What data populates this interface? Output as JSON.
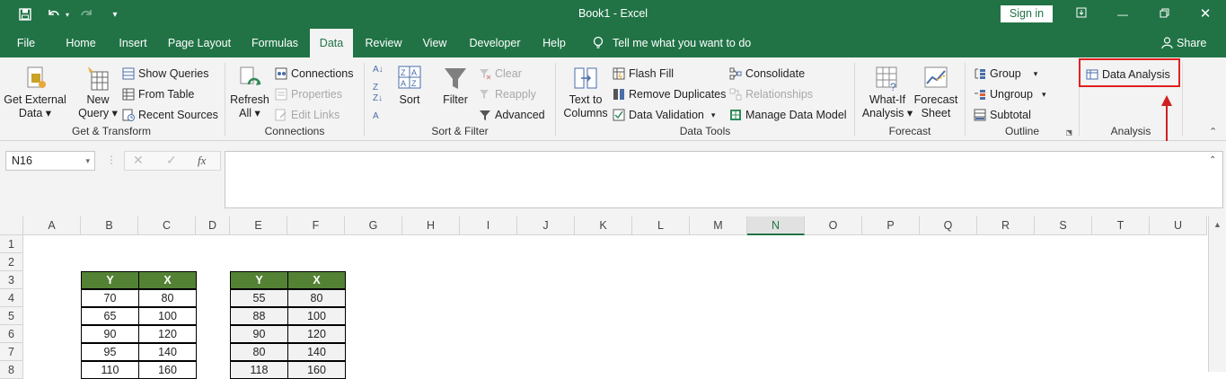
{
  "window": {
    "title": "Book1  -  Excel",
    "signin_label": "Sign in"
  },
  "qat": {
    "icons": [
      "save-icon",
      "undo-icon",
      "redo-icon",
      "customize-icon"
    ]
  },
  "tabs": [
    "File",
    "Home",
    "Insert",
    "Page Layout",
    "Formulas",
    "Data",
    "Review",
    "View",
    "Developer",
    "Help"
  ],
  "active_tab": "Data",
  "tellme": "Tell me what you want to do",
  "share": "Share",
  "ribbon": {
    "get_transform": {
      "get_external": "Get External",
      "get_external2": "Data",
      "new_query": "New",
      "new_query2": "Query",
      "show_queries": "Show Queries",
      "from_table": "From Table",
      "recent_sources": "Recent Sources",
      "label": "Get & Transform"
    },
    "connections": {
      "refresh": "Refresh",
      "refresh2": "All",
      "connections": "Connections",
      "properties": "Properties",
      "edit_links": "Edit Links",
      "label": "Connections"
    },
    "sort_filter": {
      "sort": "Sort",
      "filter": "Filter",
      "clear": "Clear",
      "reapply": "Reapply",
      "advanced": "Advanced",
      "label": "Sort & Filter"
    },
    "data_tools": {
      "text_to": "Text to",
      "columns": "Columns",
      "flash_fill": "Flash Fill",
      "remove_duplicates": "Remove Duplicates",
      "data_validation": "Data Validation",
      "consolidate": "Consolidate",
      "relationships": "Relationships",
      "manage_model": "Manage Data Model",
      "label": "Data Tools"
    },
    "forecast": {
      "whatif": "What-If",
      "whatif2": "Analysis",
      "forecast": "Forecast",
      "forecast2": "Sheet",
      "label": "Forecast"
    },
    "outline": {
      "group": "Group",
      "ungroup": "Ungroup",
      "subtotal": "Subtotal",
      "label": "Outline"
    },
    "analysis": {
      "data_analysis": "Data Analysis",
      "label": "Analysis"
    }
  },
  "formula_bar": {
    "name_box": "N16",
    "fx": "fx",
    "content": ""
  },
  "columns": [
    "A",
    "B",
    "C",
    "D",
    "E",
    "F",
    "G",
    "H",
    "I",
    "J",
    "K",
    "L",
    "M",
    "N",
    "O",
    "P",
    "Q",
    "R",
    "S",
    "T",
    "U"
  ],
  "selected_column": "N",
  "rows": [
    "1",
    "2",
    "3",
    "4",
    "5",
    "6",
    "7",
    "8"
  ],
  "table1": {
    "headers": [
      "Y",
      "X"
    ],
    "rows": [
      [
        "70",
        "80"
      ],
      [
        "65",
        "100"
      ],
      [
        "90",
        "120"
      ],
      [
        "95",
        "140"
      ],
      [
        "110",
        "160"
      ]
    ]
  },
  "table2": {
    "headers": [
      "Y",
      "X"
    ],
    "rows": [
      [
        "55",
        "80"
      ],
      [
        "88",
        "100"
      ],
      [
        "90",
        "120"
      ],
      [
        "80",
        "140"
      ],
      [
        "118",
        "160"
      ]
    ]
  },
  "colors": {
    "excel_green": "#217346",
    "header_green": "#548235",
    "highlight_red": "#e02020"
  }
}
